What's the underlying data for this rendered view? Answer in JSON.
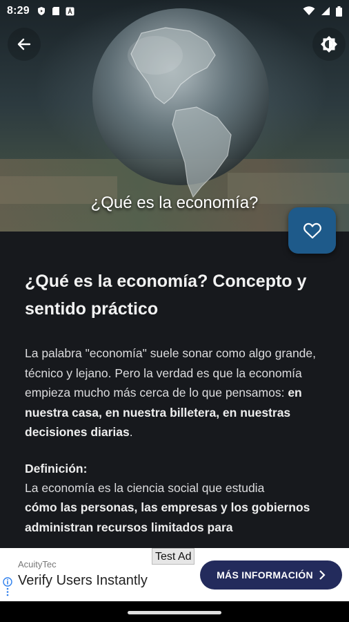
{
  "status_bar": {
    "time": "8:29",
    "left_icons": [
      "play-protect-icon",
      "sim-card-icon",
      "font-a-icon"
    ],
    "right_icons": [
      "wifi-icon",
      "signal-icon",
      "battery-icon"
    ]
  },
  "hero": {
    "caption": "¿Qué es la economía?",
    "image": "glass-globe-on-banknotes"
  },
  "article": {
    "title": "¿Qué es la economía? Concepto y sentido práctico",
    "p1_plain": "La palabra \"economía\" suele sonar como algo grande, técnico y lejano. Pero la verdad es que la economía empieza mucho más cerca de lo que pensamos: ",
    "p1_bold": "en nuestra casa, en nuestra billetera, en nuestras decisiones diarias",
    "p1_end": ".",
    "definition_heading": "Definición:",
    "definition_plain": "La economía es la ciencia social que estudia",
    "definition_bold": "cómo las personas, las empresas y los gobiernos administran recursos limitados para"
  },
  "ad": {
    "label": "Test Ad",
    "brand": "AcuityTec",
    "headline": "Verify Users Instantly",
    "cta": "MÁS INFORMACIÓN",
    "colors": {
      "cta_bg": "#232b5c",
      "info": "#2f80ed"
    }
  },
  "colors": {
    "fav_button": "#1e5a8a",
    "content_bg": "#17191d"
  }
}
